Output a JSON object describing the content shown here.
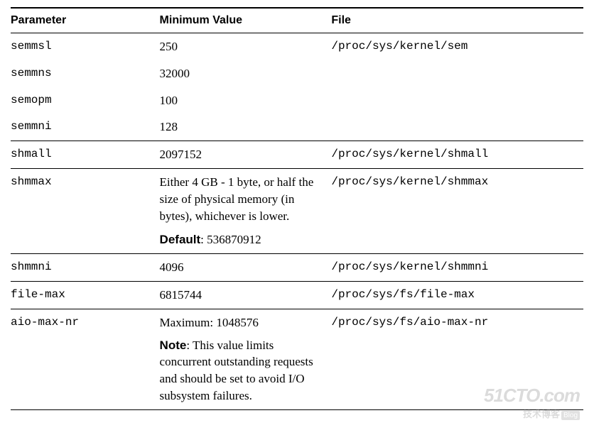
{
  "headers": {
    "parameter": "Parameter",
    "minimum": "Minimum Value",
    "file": "File"
  },
  "rows": {
    "semmsl": {
      "param": "semmsl",
      "value": "250",
      "file": "/proc/sys/kernel/sem"
    },
    "semmns": {
      "param": "semmns",
      "value": "32000",
      "file": ""
    },
    "semopm": {
      "param": "semopm",
      "value": "100",
      "file": ""
    },
    "semmni": {
      "param": "semmni",
      "value": "128",
      "file": ""
    },
    "shmall": {
      "param": "shmall",
      "value": "2097152",
      "file": "/proc/sys/kernel/shmall"
    },
    "shmmax": {
      "param": "shmmax",
      "value_text": "Either 4 GB - 1 byte, or half the size of physical memory (in bytes), whichever is lower.",
      "default_label": "Default",
      "default_value": ": 536870912",
      "file": "/proc/sys/kernel/shmmax"
    },
    "shmmni": {
      "param": "shmmni",
      "value": "4096",
      "file": "/proc/sys/kernel/shmmni"
    },
    "filemax": {
      "param": "file-max",
      "value": "6815744",
      "file": "/proc/sys/fs/file-max"
    },
    "aiomaxnr": {
      "param": "aio-max-nr",
      "value_text": "Maximum: 1048576",
      "note_label": "Note",
      "note_value": ": This value limits concurrent outstanding requests and should be set to avoid I/O subsystem failures.",
      "file": "/proc/sys/fs/aio-max-nr"
    }
  },
  "watermark": {
    "main": "51CTO.com",
    "sub": "技术博客",
    "blog": "Blog"
  }
}
